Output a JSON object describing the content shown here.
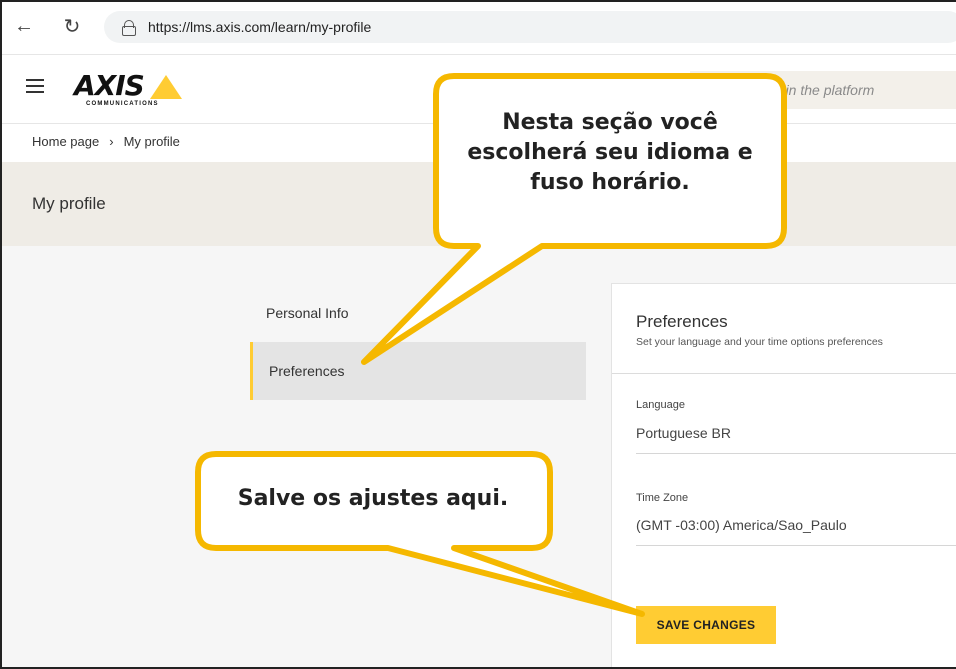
{
  "browser": {
    "url": "https://lms.axis.com/learn/my-profile",
    "back_icon": "arrow-left-icon",
    "reload_icon": "reload-icon"
  },
  "header": {
    "logo_text": "AXIS",
    "logo_sub": "COMMUNICATIONS",
    "search_placeholder": "nt in the platform"
  },
  "breadcrumb": {
    "home": "Home page",
    "separator": "›",
    "current": "My profile"
  },
  "page": {
    "title": "My profile"
  },
  "sidebar": {
    "items": [
      {
        "label": "Personal Info"
      },
      {
        "label": "Preferences"
      }
    ]
  },
  "preferences": {
    "title": "Preferences",
    "subtitle": "Set your language and your time options preferences",
    "language_label": "Language",
    "language_value": "Portuguese BR",
    "timezone_label": "Time Zone",
    "timezone_value": "(GMT -03:00) America/Sao_Paulo",
    "save_label": "SAVE CHANGES"
  },
  "callouts": {
    "section": "Nesta seção você escolherá seu idioma e fuso horário.",
    "save": "Salve os ajustes aqui."
  },
  "colors": {
    "accent": "#ffcc33",
    "callout_border": "#f5b800",
    "title_band": "#efece6"
  }
}
